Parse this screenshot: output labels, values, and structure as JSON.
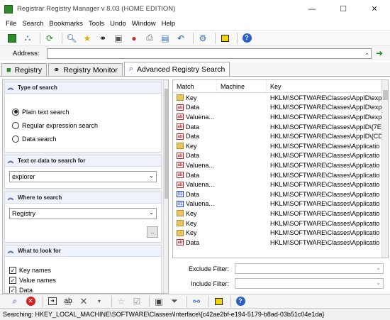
{
  "window": {
    "title": "Registrar Registry Manager v 8.03 (HOME EDITION)",
    "minimize": "—",
    "maximize": "☐",
    "close": "✕"
  },
  "menu": [
    "File",
    "Search",
    "Bookmarks",
    "Tools",
    "Undo",
    "Window",
    "Help"
  ],
  "address": {
    "label": "Address:",
    "value": ""
  },
  "tabs": [
    {
      "label": "Registry",
      "icon": "registry-icon"
    },
    {
      "label": "Registry Monitor",
      "icon": "binoculars-icon"
    },
    {
      "label": "Advanced Registry Search",
      "icon": "search-icon",
      "active": true
    }
  ],
  "search_panel": {
    "type_of_search": {
      "title": "Type of search",
      "options": [
        "Plain text search",
        "Regular expression search",
        "Data search"
      ],
      "selected": "Plain text search"
    },
    "text_to_search": {
      "title": "Text or data to search for",
      "value": "explorer"
    },
    "where_to_search": {
      "title": "Where to search",
      "value": "Registry",
      "browse_label": ".."
    },
    "what_to_look_for": {
      "title": "What to look for",
      "items": [
        {
          "label": "Key names",
          "checked": true
        },
        {
          "label": "Value names",
          "checked": true
        },
        {
          "label": "Data",
          "checked": true
        }
      ]
    }
  },
  "results": {
    "columns": [
      "Match",
      "Machine",
      "Key"
    ],
    "rows": [
      {
        "type": "key",
        "match": "Key",
        "machine": "",
        "key": "HKLM\\SOFTWARE\\Classes\\AppID\\exp"
      },
      {
        "type": "data",
        "match": "Data",
        "machine": "",
        "key": "HKLM\\SOFTWARE\\Classes\\AppID\\exp"
      },
      {
        "type": "data",
        "match": "Valuena...",
        "machine": "",
        "key": "HKLM\\SOFTWARE\\Classes\\AppID\\exp"
      },
      {
        "type": "data",
        "match": "Data",
        "machine": "",
        "key": "HKLM\\SOFTWARE\\Classes\\AppID\\{7E"
      },
      {
        "type": "data",
        "match": "Data",
        "machine": "",
        "key": "HKLM\\SOFTWARE\\Classes\\AppID\\{CD"
      },
      {
        "type": "key",
        "match": "Key",
        "machine": "",
        "key": "HKLM\\SOFTWARE\\Classes\\Applicatio"
      },
      {
        "type": "data",
        "match": "Data",
        "machine": "",
        "key": "HKLM\\SOFTWARE\\Classes\\Applicatio"
      },
      {
        "type": "data",
        "match": "Valuena...",
        "machine": "",
        "key": "HKLM\\SOFTWARE\\Classes\\Applicatio"
      },
      {
        "type": "data",
        "match": "Data",
        "machine": "",
        "key": "HKLM\\SOFTWARE\\Classes\\Applicatio"
      },
      {
        "type": "data",
        "match": "Valuena...",
        "machine": "",
        "key": "HKLM\\SOFTWARE\\Classes\\Applicatio"
      },
      {
        "type": "bin",
        "match": "Data",
        "machine": "",
        "key": "HKLM\\SOFTWARE\\Classes\\Applicatio"
      },
      {
        "type": "bin",
        "match": "Valuena...",
        "machine": "",
        "key": "HKLM\\SOFTWARE\\Classes\\Applicatio"
      },
      {
        "type": "key",
        "match": "Key",
        "machine": "",
        "key": "HKLM\\SOFTWARE\\Classes\\Applicatio"
      },
      {
        "type": "key",
        "match": "Key",
        "machine": "",
        "key": "HKLM\\SOFTWARE\\Classes\\Applicatio"
      },
      {
        "type": "key",
        "match": "Key",
        "machine": "",
        "key": "HKLM\\SOFTWARE\\Classes\\Applicatio"
      },
      {
        "type": "data",
        "match": "Data",
        "machine": "",
        "key": "HKLM\\SOFTWARE\\Classes\\Applicatio"
      }
    ]
  },
  "filters": {
    "exclude_label": "Exclude Filter:",
    "include_label": "Include Filter:"
  },
  "status": "Searching: HKEY_LOCAL_MACHINE\\SOFTWARE\\Classes\\Interface\\{c42ae2bf-e194-5179-b8ad-03b51c04e1da}"
}
